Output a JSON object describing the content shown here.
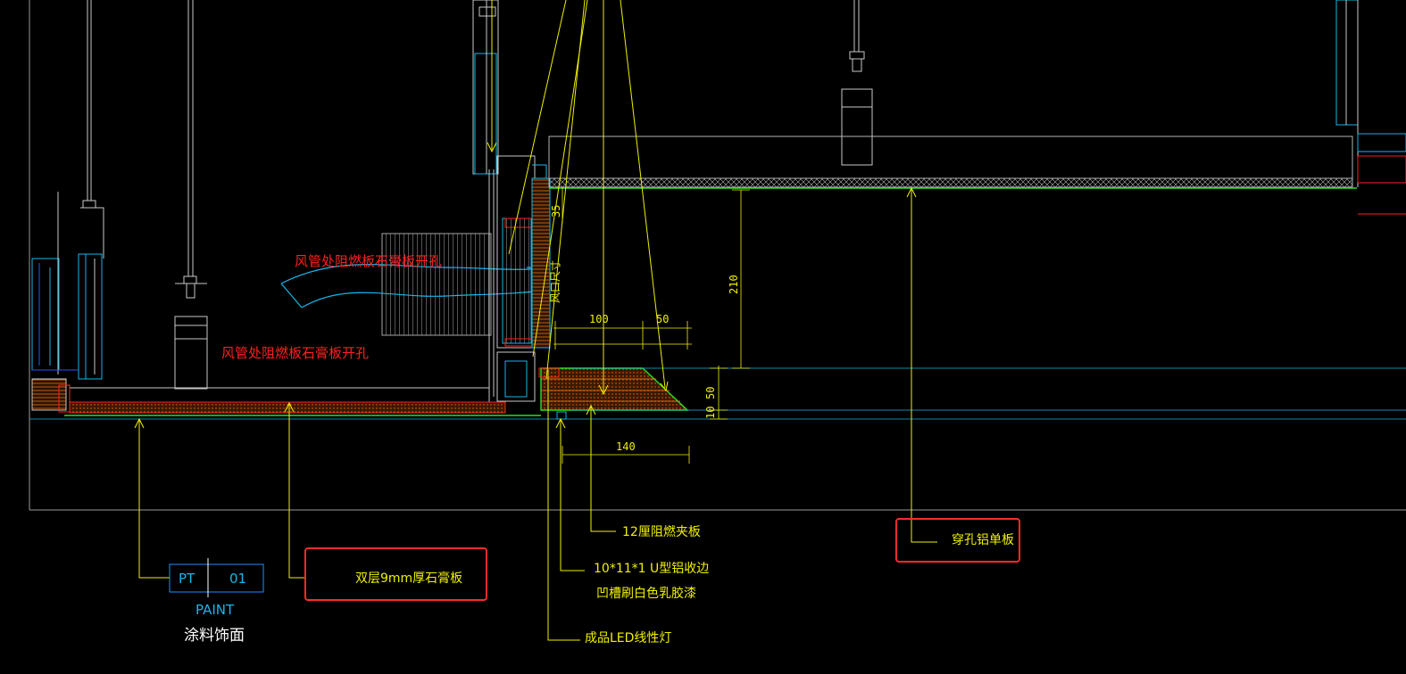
{
  "annotations": {
    "duct_opening_1": "风管处阻燃板石膏板开孔",
    "duct_opening_2": "风管处阻燃板石膏板开孔",
    "duct_size": "风口尺寸"
  },
  "dimensions": {
    "d35": "35",
    "d210": "210",
    "d100": "100",
    "d50_top": "50",
    "d50_side": "50",
    "d10": "10",
    "d140": "140"
  },
  "labels": {
    "board_12": "12厘阻燃夹板",
    "u_channel": "10*11*1  U型铝收边",
    "groove_paint": "凹槽刷白色乳胶漆",
    "led_light": "成品LED线性灯",
    "gypsum": "双层9mm厚石膏板",
    "aluminum": "穿孔铝单板",
    "pt_code": "PT",
    "pt_num": "01",
    "paint_en": "PAINT",
    "paint_cn": "涂料饰面"
  },
  "colors": {
    "yellow": "#f0f000",
    "red": "#ff2020",
    "cyan": "#19b6e8",
    "green": "#26e026",
    "white": "#ffffff",
    "grey": "#b4b4b4",
    "highlight": "#ff2a2a"
  }
}
